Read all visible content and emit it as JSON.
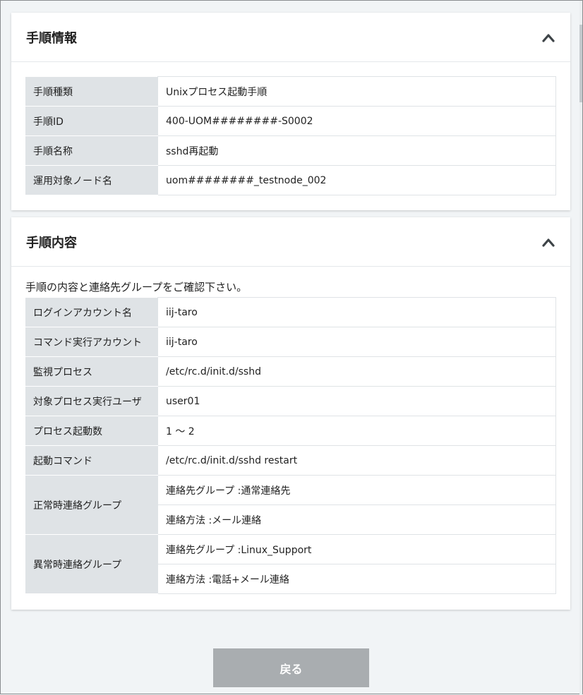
{
  "procedure_info": {
    "title": "手順情報",
    "rows": [
      {
        "label": "手順種類",
        "value": "Unixプロセス起動手順"
      },
      {
        "label": "手順ID",
        "value": "400-UOM########-S0002"
      },
      {
        "label": "手順名称",
        "value": "sshd再起動"
      },
      {
        "label": "運用対象ノード名",
        "value": "uom########_testnode_002"
      }
    ]
  },
  "procedure_content": {
    "title": "手順内容",
    "note": "手順の内容と連絡先グループをご確認下さい。",
    "rows": [
      {
        "label": "ログインアカウント名",
        "value": "iij-taro"
      },
      {
        "label": "コマンド実行アカウント",
        "value": "iij-taro"
      },
      {
        "label": "監視プロセス",
        "value": "/etc/rc.d/init.d/sshd"
      },
      {
        "label": "対象プロセス実行ユーザ",
        "value": "user01"
      },
      {
        "label": "プロセス起動数",
        "value": "1 ～ 2"
      },
      {
        "label": "起動コマンド",
        "value": "/etc/rc.d/init.d/sshd restart"
      }
    ],
    "normal_contact": {
      "label": "正常時連絡グループ",
      "group": "連絡先グループ :通常連絡先",
      "method": "連絡方法 :メール連絡"
    },
    "abnormal_contact": {
      "label": "異常時連絡グループ",
      "group": "連絡先グループ :Linux_Support",
      "method": "連絡方法 :電話+メール連絡"
    }
  },
  "back_button": {
    "label": "戻る"
  },
  "icons": {
    "collapse": "chevron-up-icon"
  }
}
